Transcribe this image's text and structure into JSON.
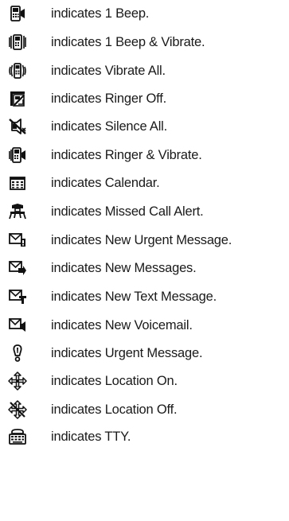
{
  "legend": {
    "items": [
      {
        "icon": "one-beep-icon",
        "text": "indicates 1 Beep."
      },
      {
        "icon": "one-beep-and-vibrate-icon",
        "text": "indicates 1 Beep & Vibrate."
      },
      {
        "icon": "vibrate-all-icon",
        "text": "indicates Vibrate All."
      },
      {
        "icon": "ringer-off-icon",
        "text": "indicates Ringer Off."
      },
      {
        "icon": "silence-all-icon",
        "text": "indicates Silence All."
      },
      {
        "icon": "ringer-and-vibrate-icon",
        "text": "indicates Ringer & Vibrate."
      },
      {
        "icon": "calendar-icon",
        "text": "indicates Calendar."
      },
      {
        "icon": "missed-call-alert-icon",
        "text": "indicates Missed Call Alert."
      },
      {
        "icon": "new-urgent-message-icon",
        "text": "indicates New Urgent Message."
      },
      {
        "icon": "new-messages-icon",
        "text": "indicates New Messages."
      },
      {
        "icon": "new-text-message-icon",
        "text": "indicates New Text Message."
      },
      {
        "icon": "new-voicemail-icon",
        "text": "indicates New Voicemail."
      },
      {
        "icon": "urgent-message-icon",
        "text": "indicates Urgent Message."
      },
      {
        "icon": "location-on-icon",
        "text": "indicates Location On."
      },
      {
        "icon": "location-off-icon",
        "text": "indicates Location Off."
      },
      {
        "icon": "tty-icon",
        "text": "indicates TTY."
      }
    ]
  }
}
